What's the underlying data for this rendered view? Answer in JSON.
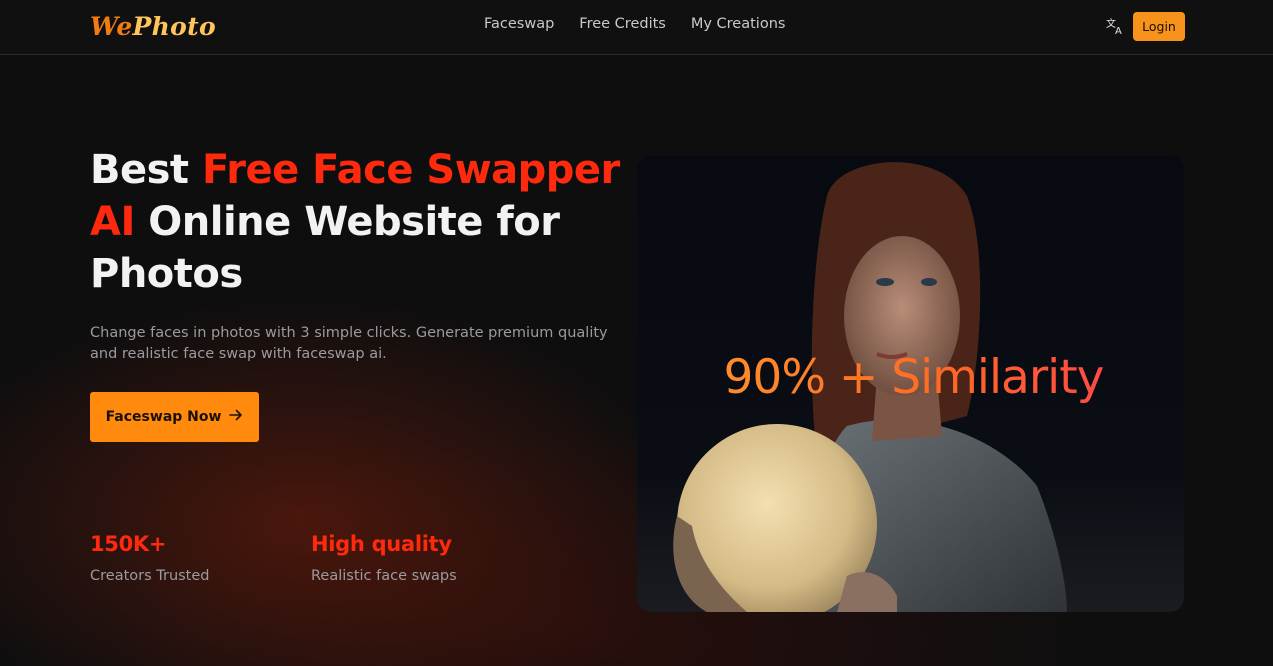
{
  "header": {
    "logo_we": "We",
    "logo_photo": "Photo",
    "nav": [
      "Faceswap",
      "Free Credits",
      "My Creations"
    ],
    "login_label": "Login"
  },
  "hero": {
    "title_part1": "Best ",
    "title_accent": "Free Face Swapper AI",
    "title_part2": " Online Website for Photos",
    "subtitle": "Change faces in photos with 3 simple clicks. Generate premium quality and realistic face swap with faceswap ai.",
    "cta_label": "Faceswap Now",
    "cta_icon": "arrow-right-icon"
  },
  "stats": [
    {
      "value": "150K+",
      "label": "Creators Trusted"
    },
    {
      "value": "High quality",
      "label": "Realistic face swaps"
    }
  ],
  "image": {
    "overlay_text": "90% + Similarity"
  },
  "colors": {
    "accent_red": "#ff2a0e",
    "accent_orange": "#ff8a0d",
    "login_orange": "#f7931a",
    "background": "#0e0e0f"
  }
}
